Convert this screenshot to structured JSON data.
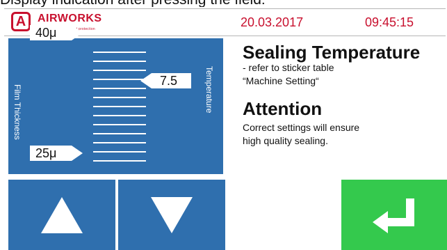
{
  "caption": "Display indication after pressing the field:",
  "header": {
    "brand": "AIRWORKS",
    "brand_letter": "A",
    "tagline": "our passion is product protection",
    "date": "20.03.2017",
    "time": "09:45:15"
  },
  "panel": {
    "left_label": "Film Thickness",
    "right_label": "Temperature",
    "max_thickness": "40μ",
    "min_thickness": "25μ",
    "current_value": "7.5"
  },
  "info": {
    "title": "Sealing Temperature",
    "line1": "- refer to sticker table",
    "line2": "“Machine Setting“",
    "attention_title": "Attention",
    "attention_line1": "Correct settings will ensure",
    "attention_line2": "high quality sealing."
  },
  "buttons": {
    "up_icon": "triangle-up-icon",
    "down_icon": "triangle-down-icon",
    "enter_icon": "enter-arrow-icon"
  },
  "colors": {
    "brand": "#c8102e",
    "panel_blue": "#2f6fae",
    "enter_green": "#34c94d"
  }
}
